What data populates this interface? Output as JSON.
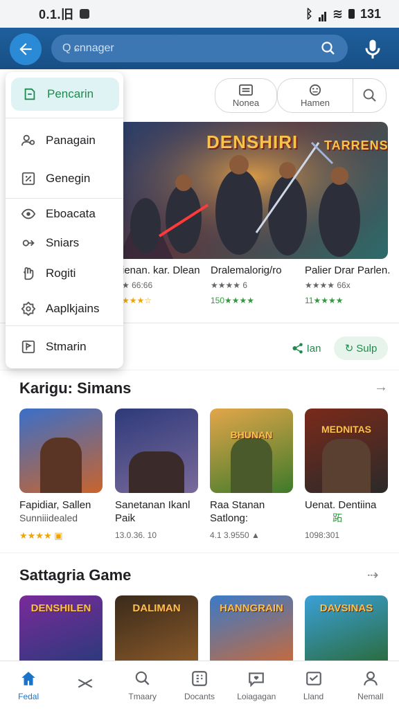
{
  "status": {
    "time": "0.1.旧",
    "right": "131"
  },
  "topbar": {
    "search_placeholder": "Q ɕnnager"
  },
  "chips": [
    {
      "label": "Nonea"
    },
    {
      "label": "Hamen"
    }
  ],
  "menu": {
    "items": [
      {
        "label": "Pencarin",
        "icon": "doc-icon"
      },
      {
        "label": "Panagain",
        "icon": "people-icon"
      },
      {
        "label": "Genegin",
        "icon": "percent-icon"
      },
      {
        "label": "Eboacata",
        "icon": "eye-icon"
      },
      {
        "label": "Sniars",
        "icon": "share-icon"
      },
      {
        "label": "Rogiti",
        "icon": "hand-icon"
      },
      {
        "label": "Aaplkjains",
        "icon": "settings-icon"
      },
      {
        "label": "Stmarin",
        "icon": "flag-icon"
      }
    ]
  },
  "banner": {
    "titles": [
      "DENSHIRI",
      "TARRENS"
    ]
  },
  "featured": [
    {
      "name": "ienan. kar. Dlean",
      "sub": "★ 66:66",
      "rating": "★★★☆"
    },
    {
      "name": "Dralemalorig/ro",
      "sub": "★★★★ 6",
      "rating": "150★★★★"
    },
    {
      "name": "Palier Drar Parlen.",
      "sub": "★★★★ 66x",
      "rating": "11★★★★"
    }
  ],
  "pills": [
    {
      "label": "Ian"
    },
    {
      "label": "Sulp"
    }
  ],
  "section1": {
    "title": "Karigu: Simans",
    "games": [
      {
        "name": "Fapidiar, Sallen",
        "sub": "Sunniiidealed",
        "meta": "★★★★ ▣",
        "tile_title": ""
      },
      {
        "name": "Sanetanan Ikanl Paik",
        "sub": "",
        "meta": "13.0.36. 10",
        "tile_title": ""
      },
      {
        "name": "Raa Stanan Satlong:",
        "sub": "",
        "meta": "4.1 3.9550 ▲",
        "tile_title": "BHUNAN"
      },
      {
        "name": "Uenat. Dentiina",
        "sub": "跖",
        "meta": "1098:301",
        "tile_title": "MEDNITAS"
      }
    ]
  },
  "section2": {
    "title": "Sattagria Game",
    "tiles": [
      "DENSHILEN",
      "DALIMAN",
      "HANNGRAIN",
      "DAVSINAS"
    ]
  },
  "nav": [
    {
      "label": "Fedal",
      "icon": "home-icon",
      "active": true
    },
    {
      "label": "",
      "icon": "games-icon",
      "active": false
    },
    {
      "label": "Tmaary",
      "icon": "search-icon",
      "active": false
    },
    {
      "label": "Docants",
      "icon": "apps-icon",
      "active": false
    },
    {
      "label": "Loiagagan",
      "icon": "heart-chat-icon",
      "active": false
    },
    {
      "label": "Lland",
      "icon": "inbox-icon",
      "active": false
    },
    {
      "label": "Nemall",
      "icon": "person-icon",
      "active": false
    }
  ],
  "colors": {
    "brand": "#1e5f9c",
    "accent": "#2a8ad6",
    "green": "#1f8a4a",
    "star": "#f0a500"
  }
}
